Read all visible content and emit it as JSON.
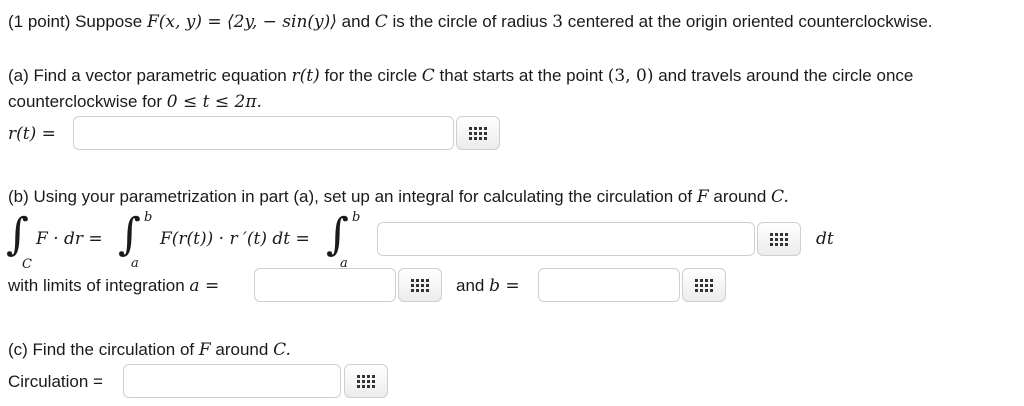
{
  "intro": {
    "points": "(1 point) Suppose",
    "field": "F(x, y) = ⟨2y, − sin(y)⟩",
    "and_c": "and",
    "c": "C",
    "rest": "is the circle of radius",
    "radius": "3",
    "rest2": "centered at the origin oriented counterclockwise."
  },
  "part_a": {
    "prompt1": "(a) Find a vector parametric equation",
    "rt": "r(t)",
    "prompt2": "for the circle",
    "prompt3": "that starts at the point",
    "point": "(3, 0)",
    "prompt4": "and travels around the circle once",
    "line2": "counterclockwise for",
    "range": "0 ≤ t ≤ 2π.",
    "label": "r(t) =",
    "value": ""
  },
  "part_b": {
    "prompt": "(b) Using your parametrization in part (a), set up an integral for calculating the circulation of",
    "prompt_f": "F",
    "prompt_end": "around",
    "prompt_c": "C.",
    "integral_lhs": "F · dr =",
    "integrand": "F(r(t)) · r ′(t) dt =",
    "sub_c": "C",
    "sup_b": "b",
    "sub_a": "a",
    "dt": "dt",
    "integrand_value": "",
    "limits_label": "with limits of integration",
    "a_label": "a =",
    "a_value": "",
    "and_b_label": "and",
    "b_label": "b =",
    "b_value": ""
  },
  "part_c": {
    "prompt": "(c) Find the circulation of",
    "prompt_f": "F",
    "prompt_end": "around",
    "prompt_c": "C.",
    "label": "Circulation =",
    "value": ""
  },
  "icons": {
    "equation_editor": "grid-icon"
  }
}
